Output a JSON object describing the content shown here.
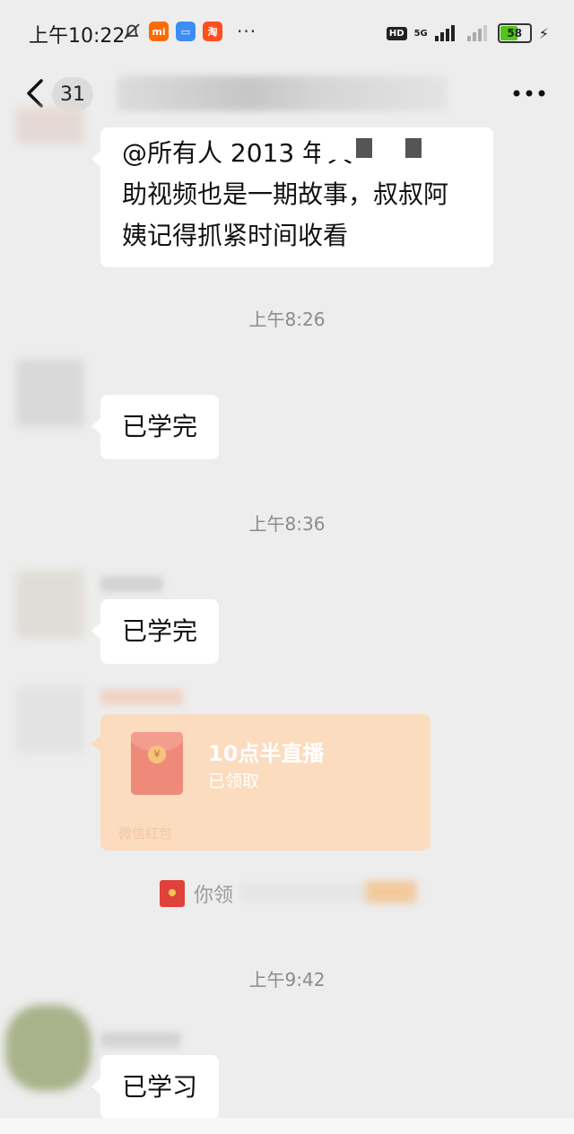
{
  "status_bar": {
    "time": "上午10:22",
    "mi_label": "mi",
    "taobao_label": "淘",
    "more_dots": "···",
    "hd": "HD",
    "network": "5G",
    "battery": "58"
  },
  "nav": {
    "unread_count": "31",
    "back_icon": "chevron-left-icon",
    "more_icon": "more-dots-icon"
  },
  "messages": [
    {
      "text_line1": "@所有人 2013 年天",
      "text_line2": "助视频也是一期故事，叔叔阿",
      "text_line3": "姨记得抓紧时间收看"
    },
    {
      "timestamp": "上午8:26",
      "text": "已学完"
    },
    {
      "timestamp": "上午8:36",
      "text": "已学完"
    }
  ],
  "red_packet": {
    "title": "10点半直播",
    "status": "已领取",
    "footer": "微信红包",
    "coin_symbol": "¥"
  },
  "system_note": {
    "text": "你领"
  },
  "last": {
    "timestamp": "上午9:42",
    "text": "已学习"
  },
  "colors": {
    "background": "#ededed",
    "bubble": "#ffffff",
    "red_packet": "#fbdcbf",
    "battery_fill": "#52c41a"
  }
}
